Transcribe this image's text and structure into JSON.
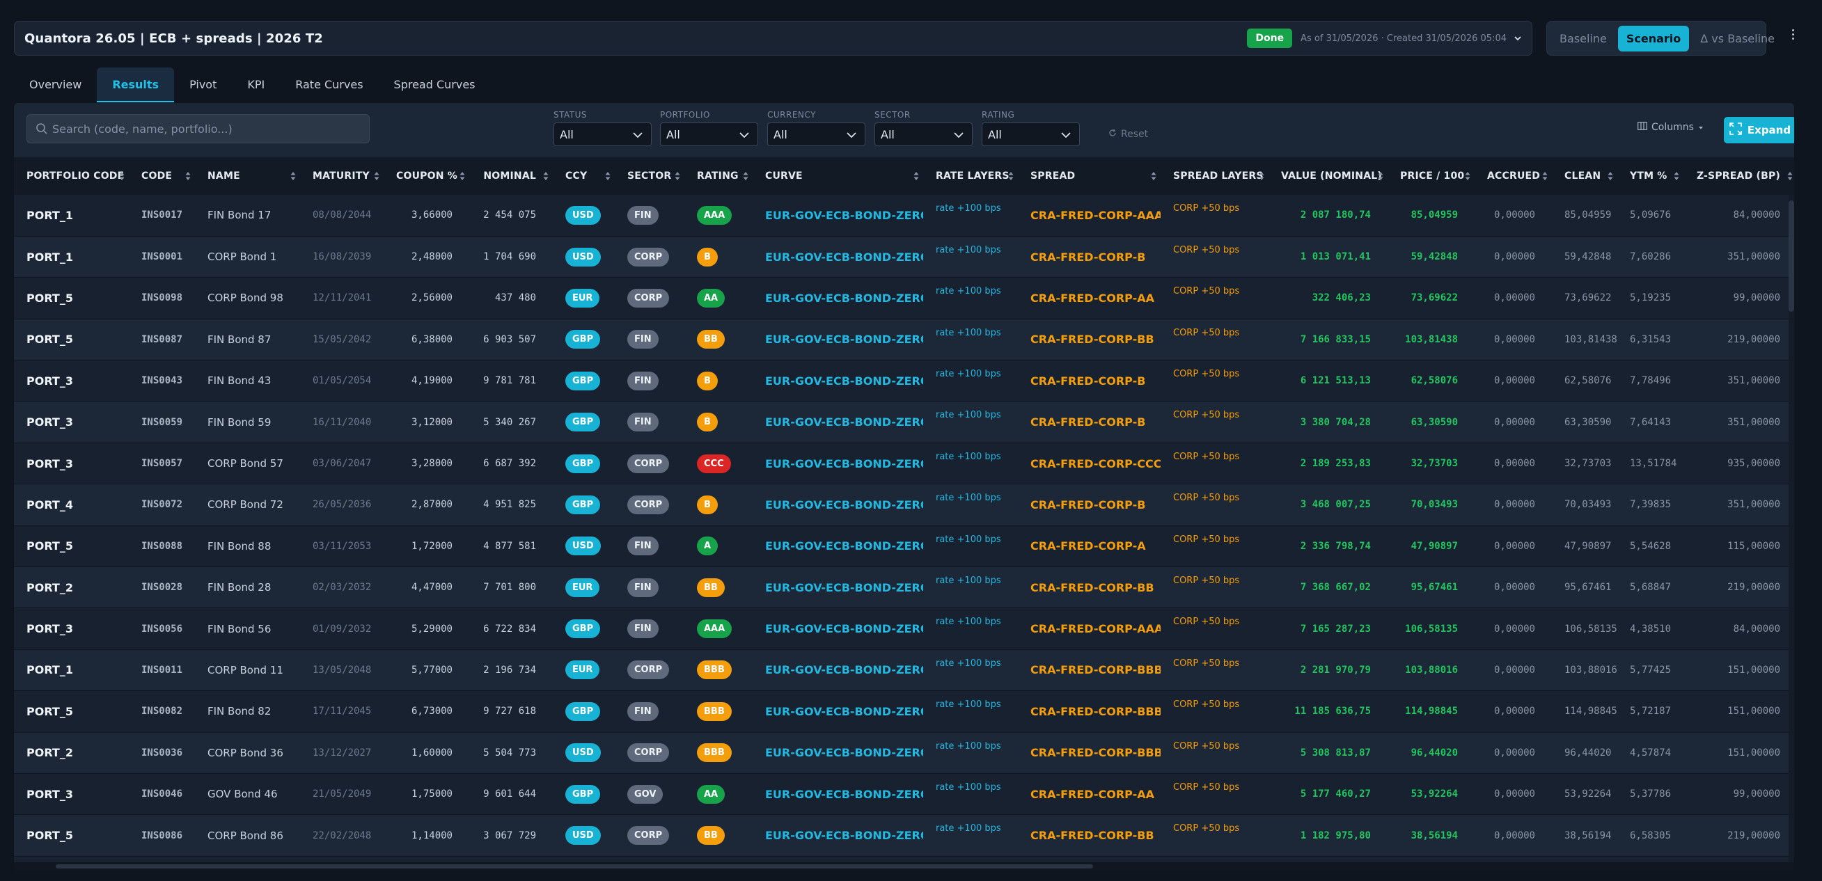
{
  "header": {
    "title": "Quantora 26.05 | ECB + spreads | 2026 T2",
    "status": "Done",
    "asof": "As of 31/05/2026 · Created 31/05/2026 05:04"
  },
  "modes": [
    "Baseline",
    "Scenario",
    "Δ vs Baseline"
  ],
  "active_mode": "Scenario",
  "tabs": [
    "Overview",
    "Results",
    "Pivot",
    "KPI",
    "Rate Curves",
    "Spread Curves"
  ],
  "active_tab": "Results",
  "search": {
    "placeholder": "Search (code, name, portfolio...)"
  },
  "filters": [
    {
      "label": "STATUS",
      "value": "All"
    },
    {
      "label": "PORTFOLIO",
      "value": "All"
    },
    {
      "label": "CURRENCY",
      "value": "All"
    },
    {
      "label": "SECTOR",
      "value": "All"
    },
    {
      "label": "RATING",
      "value": "All"
    }
  ],
  "reset_label": "Reset",
  "columns_label": "Columns",
  "expand_label": "Expand",
  "colors": {
    "accent": "#17b2d4",
    "done": "#16a34a",
    "positive": "#22c55e",
    "spread": "#f59e0b",
    "rating_AAA": "#16a34a",
    "rating_AA": "#16a34a",
    "rating_A": "#16a34a",
    "rating_BBB": "#f59e0b",
    "rating_BB": "#f59e0b",
    "rating_B": "#f59e0b",
    "rating_CCC": "#dc2626"
  },
  "table": {
    "columns": [
      "PORTFOLIO CODE",
      "CODE",
      "NAME",
      "MATURITY",
      "COUPON %",
      "NOMINAL",
      "CCY",
      "SECTOR",
      "RATING",
      "CURVE",
      "RATE LAYERS",
      "SPREAD",
      "SPREAD LAYERS",
      "VALUE (NOMINAL)",
      "PRICE / 100",
      "ACCRUED",
      "CLEAN",
      "YTM %",
      "Z-SPREAD (BP)"
    ],
    "rows": [
      [
        "PORT_1",
        "INS0017",
        "FIN Bond 17",
        "08/08/2044",
        "3,66000",
        "2 454 075",
        "USD",
        "FIN",
        "AAA",
        "EUR-GOV-ECB-BOND-ZERO",
        "rate +100 bps",
        "CRA-FRED-CORP-AAA",
        "CORP +50 bps",
        "2 087 180,74",
        "85,04959",
        "0,00000",
        "85,04959",
        "5,09676",
        "84,00000"
      ],
      [
        "PORT_1",
        "INS0001",
        "CORP Bond 1",
        "16/08/2039",
        "2,48000",
        "1 704 690",
        "USD",
        "CORP",
        "B",
        "EUR-GOV-ECB-BOND-ZERO",
        "rate +100 bps",
        "CRA-FRED-CORP-B",
        "CORP +50 bps",
        "1 013 071,41",
        "59,42848",
        "0,00000",
        "59,42848",
        "7,60286",
        "351,00000"
      ],
      [
        "PORT_5",
        "INS0098",
        "CORP Bond 98",
        "12/11/2041",
        "2,56000",
        "437 480",
        "EUR",
        "CORP",
        "AA",
        "EUR-GOV-ECB-BOND-ZERO",
        "rate +100 bps",
        "CRA-FRED-CORP-AA",
        "CORP +50 bps",
        "322 406,23",
        "73,69622",
        "0,00000",
        "73,69622",
        "5,19235",
        "99,00000"
      ],
      [
        "PORT_5",
        "INS0087",
        "FIN Bond 87",
        "15/05/2042",
        "6,38000",
        "6 903 507",
        "GBP",
        "FIN",
        "BB",
        "EUR-GOV-ECB-BOND-ZERO",
        "rate +100 bps",
        "CRA-FRED-CORP-BB",
        "CORP +50 bps",
        "7 166 833,15",
        "103,81438",
        "0,00000",
        "103,81438",
        "6,31543",
        "219,00000"
      ],
      [
        "PORT_3",
        "INS0043",
        "FIN Bond 43",
        "01/05/2054",
        "4,19000",
        "9 781 781",
        "GBP",
        "FIN",
        "B",
        "EUR-GOV-ECB-BOND-ZERO",
        "rate +100 bps",
        "CRA-FRED-CORP-B",
        "CORP +50 bps",
        "6 121 513,13",
        "62,58076",
        "0,00000",
        "62,58076",
        "7,78496",
        "351,00000"
      ],
      [
        "PORT_3",
        "INS0059",
        "FIN Bond 59",
        "16/11/2040",
        "3,12000",
        "5 340 267",
        "GBP",
        "FIN",
        "B",
        "EUR-GOV-ECB-BOND-ZERO",
        "rate +100 bps",
        "CRA-FRED-CORP-B",
        "CORP +50 bps",
        "3 380 704,28",
        "63,30590",
        "0,00000",
        "63,30590",
        "7,64143",
        "351,00000"
      ],
      [
        "PORT_3",
        "INS0057",
        "CORP Bond 57",
        "03/06/2047",
        "3,28000",
        "6 687 392",
        "GBP",
        "CORP",
        "CCC",
        "EUR-GOV-ECB-BOND-ZERO",
        "rate +100 bps",
        "CRA-FRED-CORP-CCC",
        "CORP +50 bps",
        "2 189 253,83",
        "32,73703",
        "0,00000",
        "32,73703",
        "13,51784",
        "935,00000"
      ],
      [
        "PORT_4",
        "INS0072",
        "CORP Bond 72",
        "26/05/2036",
        "2,87000",
        "4 951 825",
        "GBP",
        "CORP",
        "B",
        "EUR-GOV-ECB-BOND-ZERO",
        "rate +100 bps",
        "CRA-FRED-CORP-B",
        "CORP +50 bps",
        "3 468 007,25",
        "70,03493",
        "0,00000",
        "70,03493",
        "7,39835",
        "351,00000"
      ],
      [
        "PORT_5",
        "INS0088",
        "FIN Bond 88",
        "03/11/2053",
        "1,72000",
        "4 877 581",
        "USD",
        "FIN",
        "A",
        "EUR-GOV-ECB-BOND-ZERO",
        "rate +100 bps",
        "CRA-FRED-CORP-A",
        "CORP +50 bps",
        "2 336 798,74",
        "47,90897",
        "0,00000",
        "47,90897",
        "5,54628",
        "115,00000"
      ],
      [
        "PORT_2",
        "INS0028",
        "FIN Bond 28",
        "02/03/2032",
        "4,47000",
        "7 701 800",
        "EUR",
        "FIN",
        "BB",
        "EUR-GOV-ECB-BOND-ZERO",
        "rate +100 bps",
        "CRA-FRED-CORP-BB",
        "CORP +50 bps",
        "7 368 667,02",
        "95,67461",
        "0,00000",
        "95,67461",
        "5,68847",
        "219,00000"
      ],
      [
        "PORT_3",
        "INS0056",
        "FIN Bond 56",
        "01/09/2032",
        "5,29000",
        "6 722 834",
        "GBP",
        "FIN",
        "AAA",
        "EUR-GOV-ECB-BOND-ZERO",
        "rate +100 bps",
        "CRA-FRED-CORP-AAA",
        "CORP +50 bps",
        "7 165 287,23",
        "106,58135",
        "0,00000",
        "106,58135",
        "4,38510",
        "84,00000"
      ],
      [
        "PORT_1",
        "INS0011",
        "CORP Bond 11",
        "13/05/2048",
        "5,77000",
        "2 196 734",
        "EUR",
        "CORP",
        "BBB",
        "EUR-GOV-ECB-BOND-ZERO",
        "rate +100 bps",
        "CRA-FRED-CORP-BBB",
        "CORP +50 bps",
        "2 281 970,79",
        "103,88016",
        "0,00000",
        "103,88016",
        "5,77425",
        "151,00000"
      ],
      [
        "PORT_5",
        "INS0082",
        "FIN Bond 82",
        "17/11/2045",
        "6,73000",
        "9 727 618",
        "GBP",
        "FIN",
        "BBB",
        "EUR-GOV-ECB-BOND-ZERO",
        "rate +100 bps",
        "CRA-FRED-CORP-BBB",
        "CORP +50 bps",
        "11 185 636,75",
        "114,98845",
        "0,00000",
        "114,98845",
        "5,72187",
        "151,00000"
      ],
      [
        "PORT_2",
        "INS0036",
        "CORP Bond 36",
        "13/12/2027",
        "1,60000",
        "5 504 773",
        "USD",
        "CORP",
        "BBB",
        "EUR-GOV-ECB-BOND-ZERO",
        "rate +100 bps",
        "CRA-FRED-CORP-BBB",
        "CORP +50 bps",
        "5 308 813,87",
        "96,44020",
        "0,00000",
        "96,44020",
        "4,57874",
        "151,00000"
      ],
      [
        "PORT_3",
        "INS0046",
        "GOV Bond 46",
        "21/05/2049",
        "1,75000",
        "9 601 644",
        "GBP",
        "GOV",
        "AA",
        "EUR-GOV-ECB-BOND-ZERO",
        "rate +100 bps",
        "CRA-FRED-CORP-AA",
        "CORP +50 bps",
        "5 177 460,27",
        "53,92264",
        "0,00000",
        "53,92264",
        "5,37786",
        "99,00000"
      ],
      [
        "PORT_5",
        "INS0086",
        "CORP Bond 86",
        "22/02/2048",
        "1,14000",
        "3 067 729",
        "USD",
        "CORP",
        "BB",
        "EUR-GOV-ECB-BOND-ZERO",
        "rate +100 bps",
        "CRA-FRED-CORP-BB",
        "CORP +50 bps",
        "1 182 975,80",
        "38,56194",
        "0,00000",
        "38,56194",
        "6,58305",
        "219,00000"
      ]
    ]
  }
}
